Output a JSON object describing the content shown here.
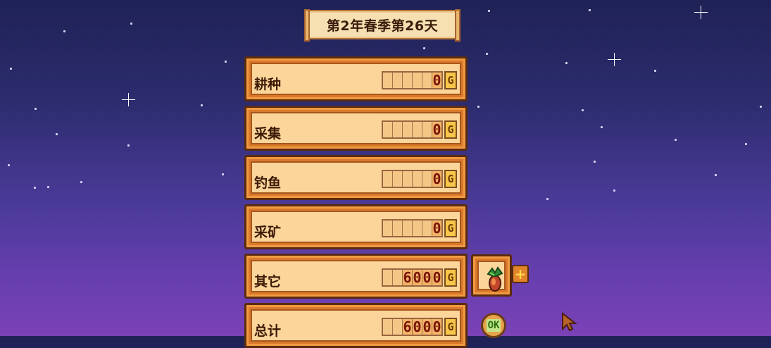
{
  "date_title": "第2年春季第26天",
  "rows": [
    {
      "label": "耕种",
      "digits": [
        "",
        "",
        "",
        "",
        "",
        "0"
      ]
    },
    {
      "label": "采集",
      "digits": [
        "",
        "",
        "",
        "",
        "",
        "0"
      ]
    },
    {
      "label": "钓鱼",
      "digits": [
        "",
        "",
        "",
        "",
        "",
        "0"
      ]
    },
    {
      "label": "采矿",
      "digits": [
        "",
        "",
        "",
        "",
        "",
        "0"
      ]
    },
    {
      "label": "其它",
      "digits": [
        "",
        "",
        "6",
        "0",
        "0",
        "0"
      ]
    },
    {
      "label": "总计",
      "digits": [
        "",
        "",
        "6",
        "0",
        "0",
        "0"
      ]
    }
  ],
  "currency_symbol": "G",
  "item": {
    "icon": "radish-icon"
  },
  "plus_label": "+",
  "ok_label": "OK",
  "colors": {
    "panel": "#d9792a",
    "panel_inner": "#fbd59a",
    "gold": "#f7c64a"
  }
}
